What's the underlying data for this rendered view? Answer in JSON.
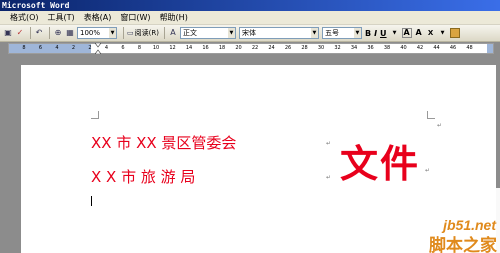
{
  "window": {
    "title": "Microsoft Word"
  },
  "menu": {
    "items": [
      "格式(O)",
      "工具(T)",
      "表格(A)",
      "窗口(W)",
      "帮助(H)"
    ]
  },
  "toolbar": {
    "zoom": "100%",
    "read_label": "阅读(R)",
    "style": "正文",
    "font": "宋体",
    "size": "五号",
    "bold": "B",
    "italic": "I",
    "underline": "U"
  },
  "ruler": {
    "numbers": [
      "8",
      "6",
      "4",
      "2",
      "2",
      "4",
      "6",
      "8",
      "10",
      "12",
      "14",
      "16",
      "18",
      "20",
      "22",
      "24",
      "26",
      "28",
      "30",
      "32",
      "34",
      "36",
      "38",
      "40",
      "42",
      "44",
      "46",
      "48"
    ]
  },
  "document": {
    "line1": "XX 市 XX 景区管委会",
    "line2": "X  X   市  旅  游  局",
    "big_title": "文件"
  },
  "watermark": {
    "url": "jb51.net",
    "name": "脚本之家"
  },
  "colors": {
    "document_red": "#e8001c",
    "titlebar": "#0a246a",
    "watermark": "#e08a1c"
  }
}
